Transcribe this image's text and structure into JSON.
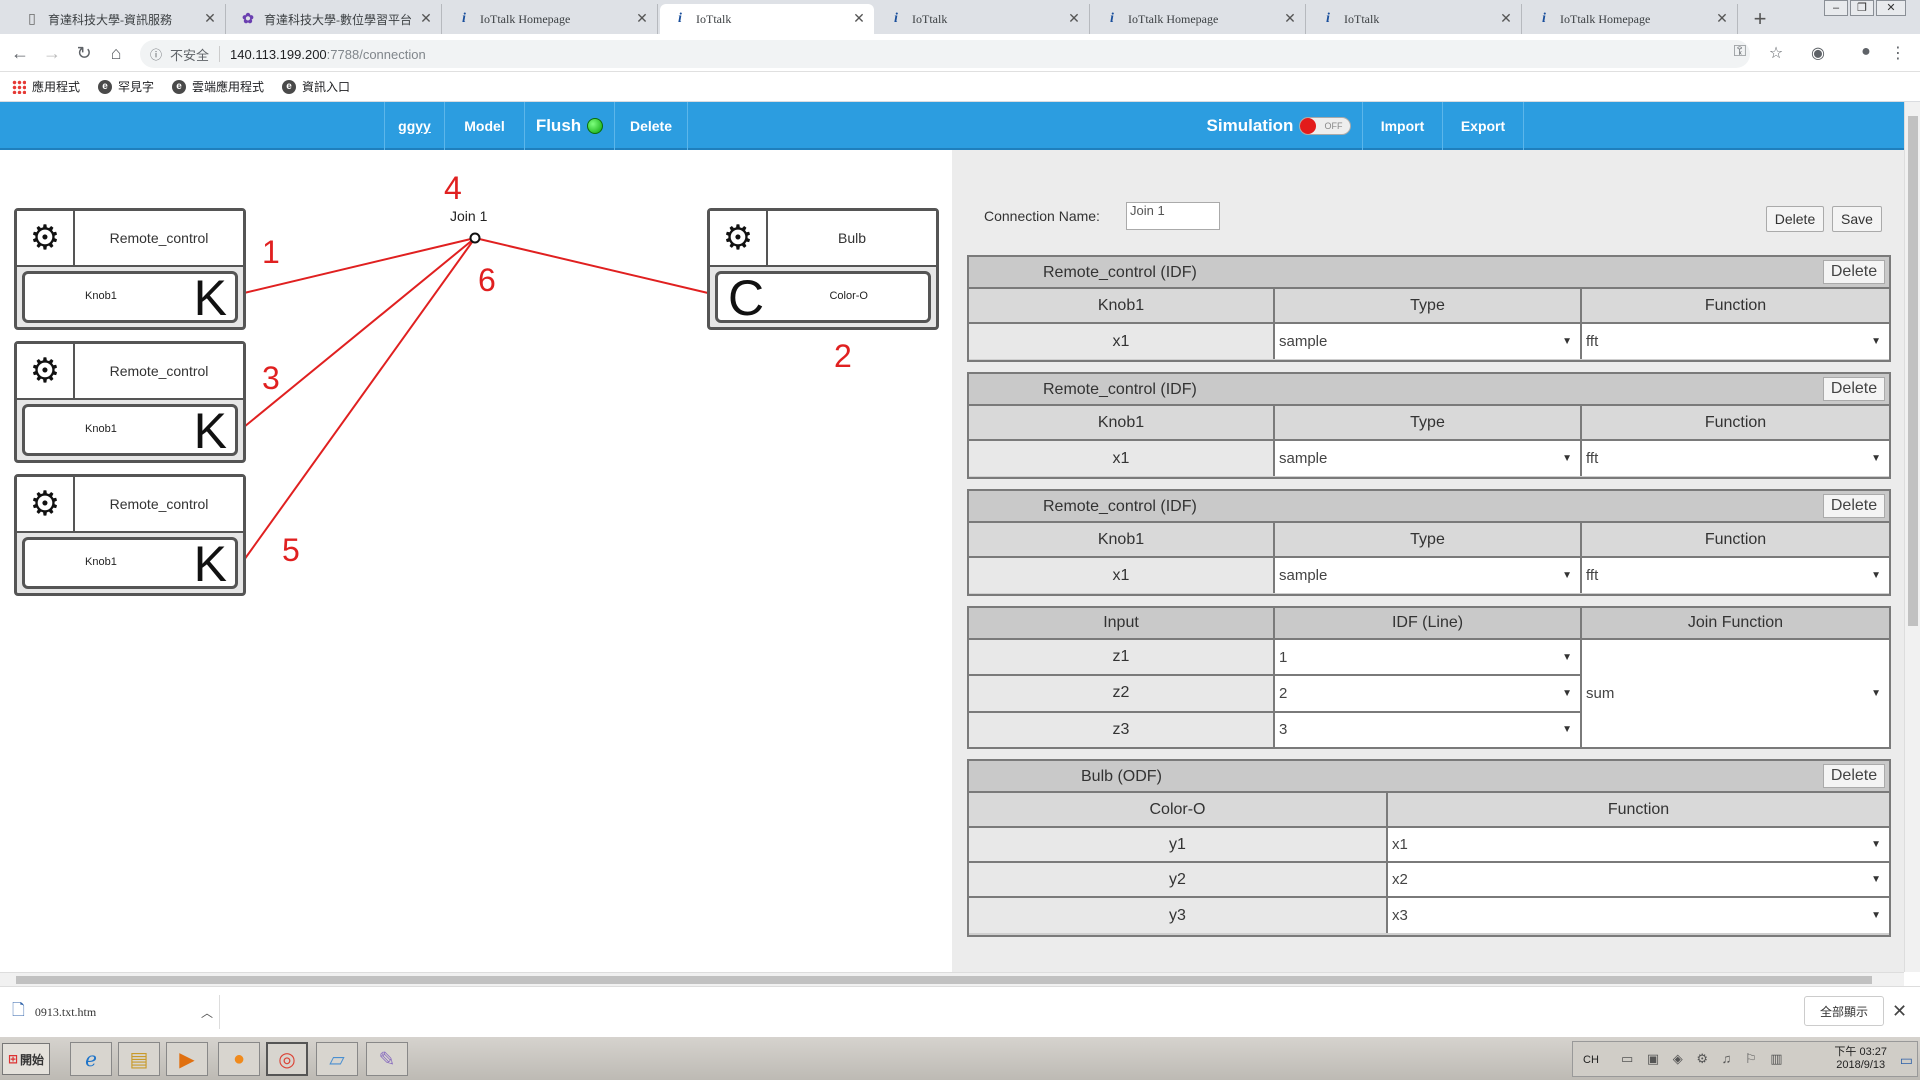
{
  "browser": {
    "tabs": [
      {
        "title": "育達科技大學-資訊服務",
        "icon": "page-icon"
      },
      {
        "title": "育達科技大學-數位學習平台",
        "icon": "flower-icon"
      },
      {
        "title": "IoTtalk Homepage",
        "icon": "info-icon"
      },
      {
        "title": "IoTtalk",
        "icon": "info-icon",
        "active": true
      },
      {
        "title": "IoTtalk",
        "icon": "info-icon"
      },
      {
        "title": "IoTtalk Homepage",
        "icon": "info-icon"
      },
      {
        "title": "IoTtalk",
        "icon": "info-icon"
      },
      {
        "title": "IoTtalk Homepage",
        "icon": "info-icon"
      }
    ],
    "address": {
      "security": "不安全",
      "host": "140.113.199.200",
      "path": ":7788/connection"
    },
    "bookmarks": [
      "應用程式",
      "罕見字",
      "雲端應用程式",
      "資訊入口"
    ]
  },
  "navbar": {
    "items": [
      "ggyy",
      "Model",
      "Flush",
      "Delete"
    ],
    "simulation": "Simulation",
    "sim_state": "OFF",
    "import": "Import",
    "export": "Export"
  },
  "canvas": {
    "join_label": "Join 1",
    "idf_devices": [
      {
        "name": "Remote_control",
        "feature": "Knob1",
        "letter": "K"
      },
      {
        "name": "Remote_control",
        "feature": "Knob1",
        "letter": "K"
      },
      {
        "name": "Remote_control",
        "feature": "Knob1",
        "letter": "K"
      }
    ],
    "odf_device": {
      "name": "Bulb",
      "feature": "Color-O",
      "letter": "C"
    },
    "annotations": [
      "1",
      "2",
      "3",
      "4",
      "5",
      "6"
    ]
  },
  "panel": {
    "conn_name_label": "Connection Name:",
    "conn_name": "Join 1",
    "delete": "Delete",
    "save": "Save",
    "idf_blocks": [
      {
        "title": "Remote_control (IDF)",
        "feature": "Knob1",
        "type_hdr": "Type",
        "func_hdr": "Function",
        "var": "x1",
        "type": "sample",
        "func": "fft"
      },
      {
        "title": "Remote_control (IDF)",
        "feature": "Knob1",
        "type_hdr": "Type",
        "func_hdr": "Function",
        "var": "x1",
        "type": "sample",
        "func": "fft"
      },
      {
        "title": "Remote_control (IDF)",
        "feature": "Knob1",
        "type_hdr": "Type",
        "func_hdr": "Function",
        "var": "x1",
        "type": "sample",
        "func": "fft"
      }
    ],
    "join": {
      "headers": [
        "Input",
        "IDF (Line)",
        "Join Function"
      ],
      "rows": [
        {
          "input": "z1",
          "line": "1"
        },
        {
          "input": "z2",
          "line": "2"
        },
        {
          "input": "z3",
          "line": "3"
        }
      ],
      "func": "sum"
    },
    "odf": {
      "title": "Bulb (ODF)",
      "feature": "Color-O",
      "func_hdr": "Function",
      "rows": [
        {
          "var": "y1",
          "func": "x1"
        },
        {
          "var": "y2",
          "func": "x2"
        },
        {
          "var": "y3",
          "func": "x3"
        }
      ]
    },
    "block_delete": "Delete"
  },
  "downloads": {
    "file": "0913.txt.htm",
    "show_all": "全部顯示"
  },
  "taskbar": {
    "start": "開始",
    "lang": "CH",
    "time": "下午 03:27",
    "date": "2018/9/13"
  },
  "colors": {
    "navbar": "#2c9de0",
    "link_line": "#e02020",
    "annotation": "#e02020",
    "led_on": "#0aa30a",
    "sim_off": "#e31b1b"
  }
}
